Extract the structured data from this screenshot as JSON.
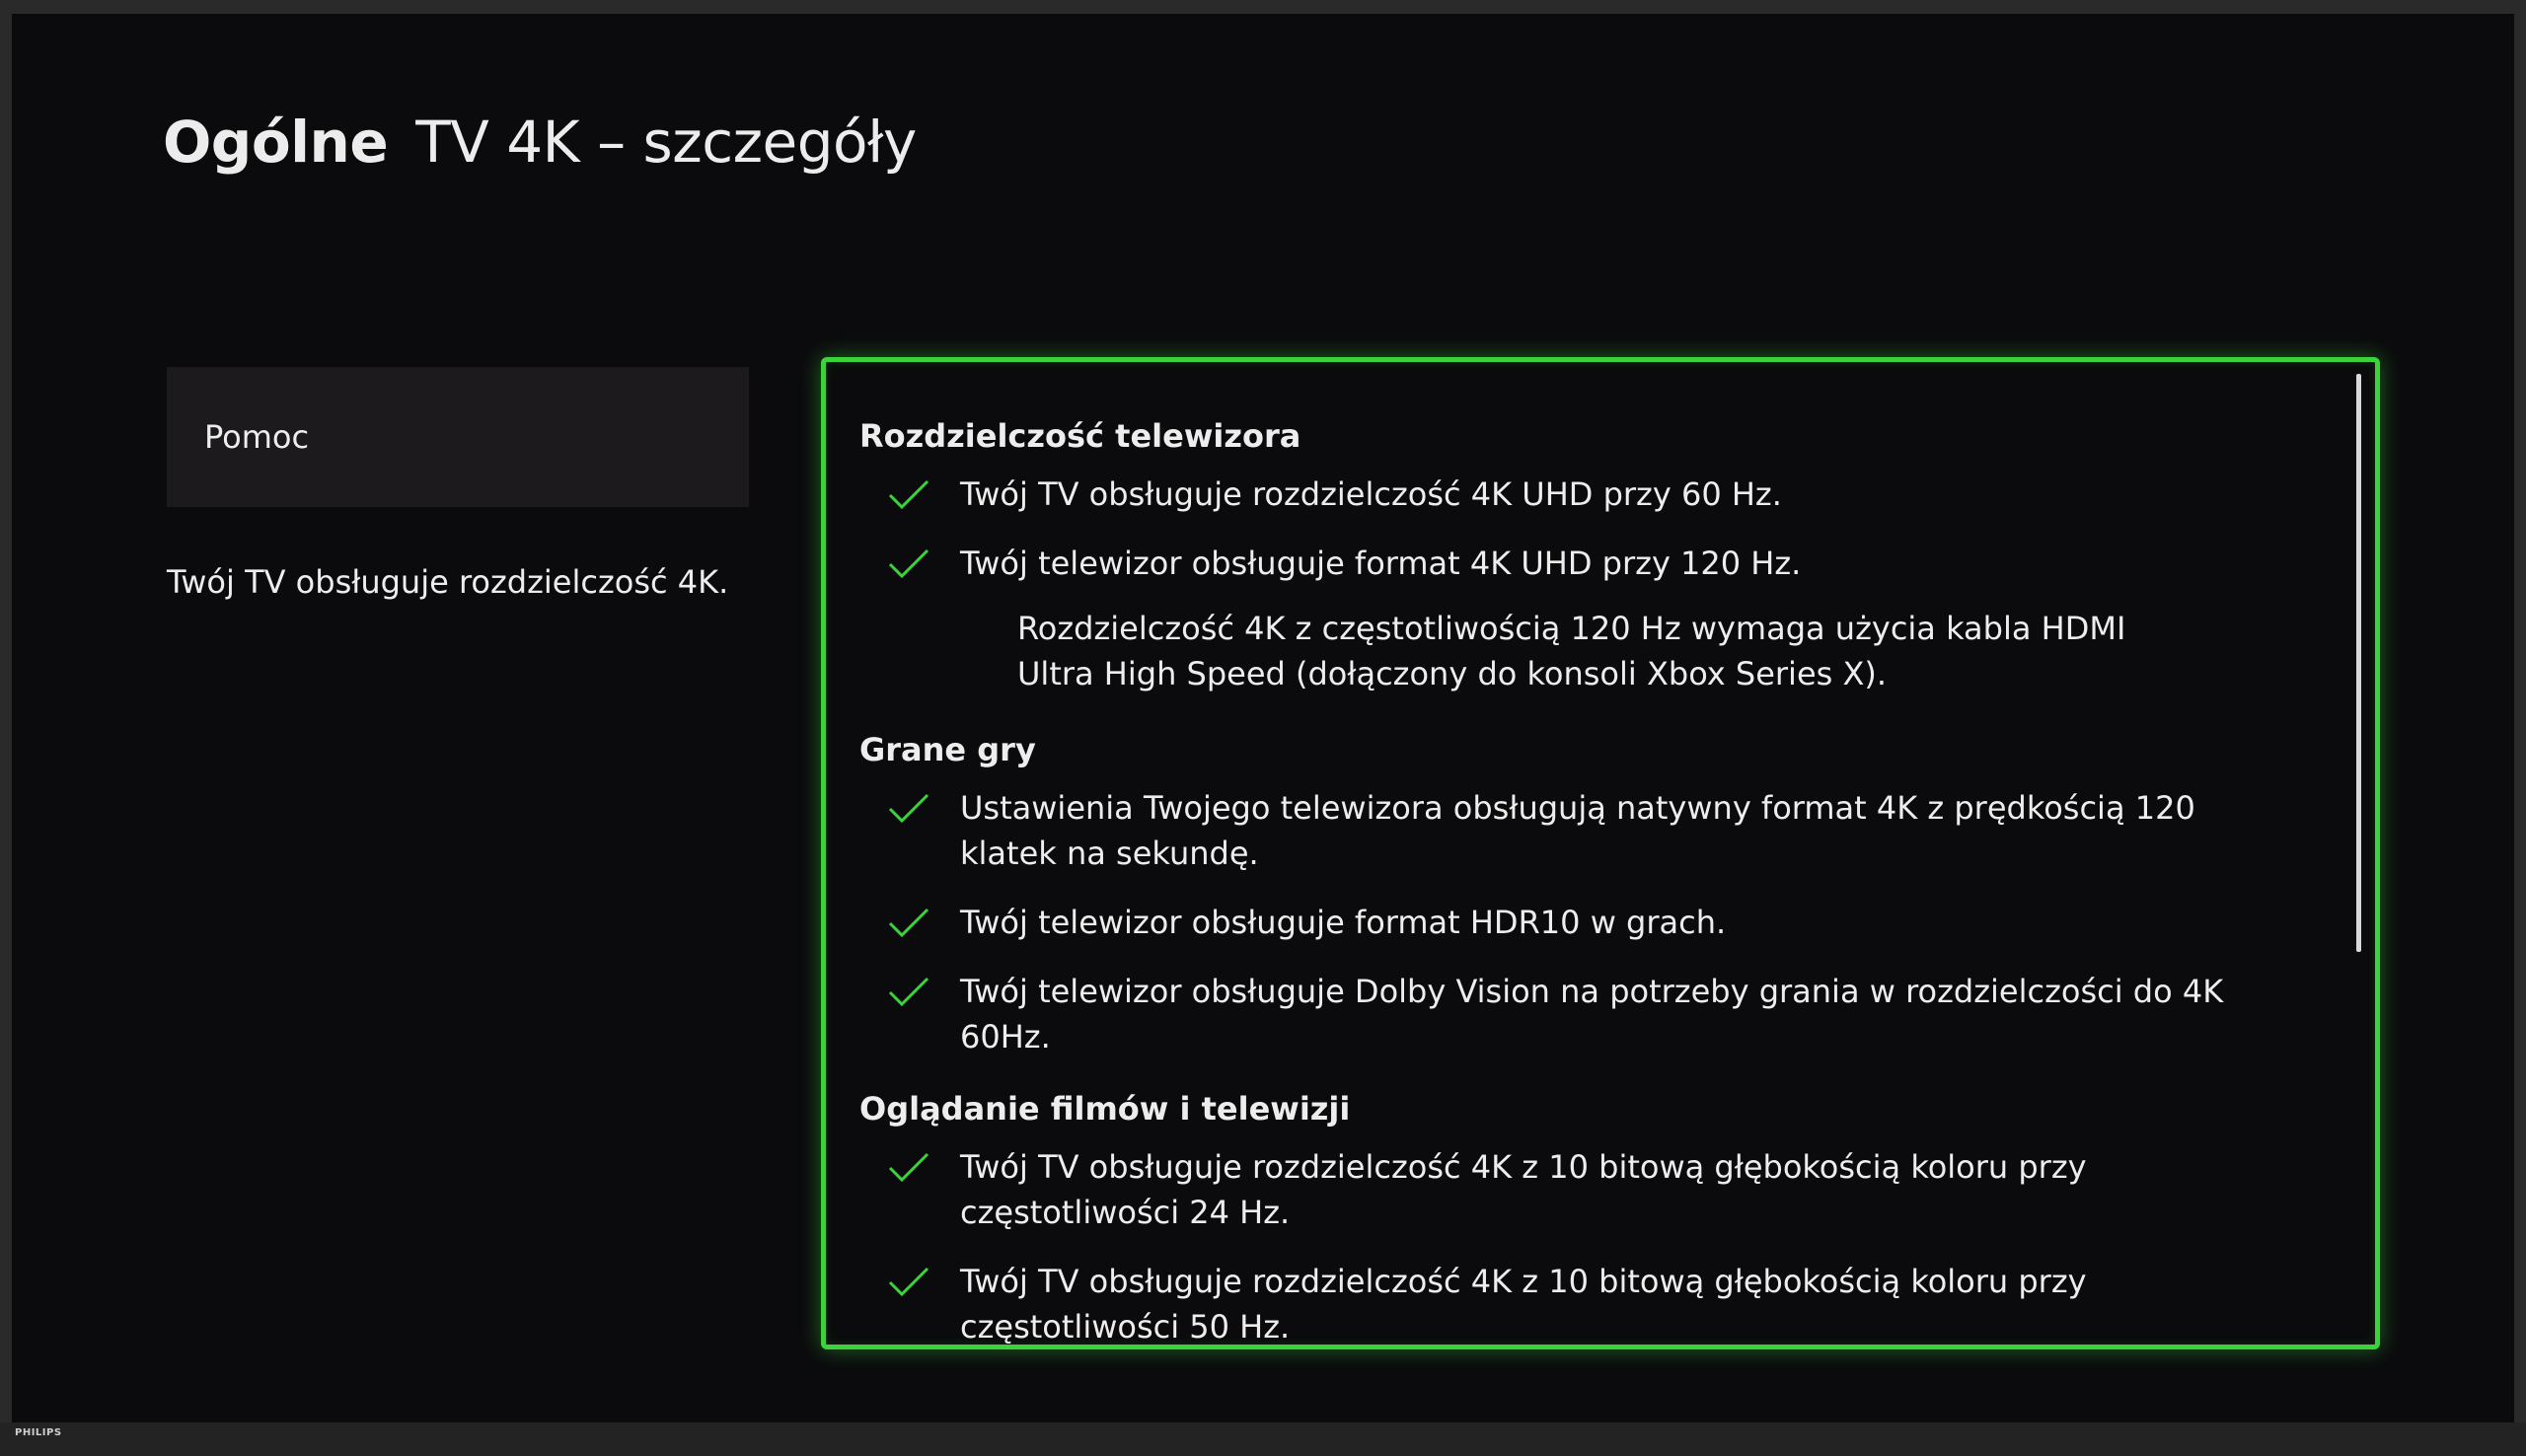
{
  "header": {
    "section": "Ogólne",
    "title": "TV 4K – szczegóły"
  },
  "sidebar": {
    "help_label": "Pomoc",
    "description": "Twój TV obsługuje rozdzielczość 4K."
  },
  "details": {
    "groups": [
      {
        "title": "Rozdzielczość telewizora",
        "items": [
          "Twój TV obsługuje rozdzielczość 4K UHD przy 60 Hz.",
          "Twój telewizor obsługuje format 4K UHD przy 120 Hz."
        ],
        "note": "Rozdzielczość 4K z częstotliwością 120 Hz wymaga użycia kabla HDMI Ultra High Speed (dołączony do konsoli Xbox Series X)."
      },
      {
        "title": "Grane gry",
        "items": [
          "Ustawienia Twojego telewizora obsługują natywny format 4K z prędkością 120 klatek na sekundę.",
          "Twój telewizor obsługuje format HDR10 w grach.",
          "Twój telewizor obsługuje Dolby Vision na potrzeby grania w rozdzielczości do 4K 60Hz."
        ]
      },
      {
        "title": "Oglądanie filmów i telewizji",
        "items": [
          "Twój TV obsługuje rozdzielczość 4K z 10 bitową głębokością koloru przy częstotliwości 24 Hz.",
          "Twój TV obsługuje rozdzielczość 4K z 10 bitową głębokością koloru przy częstotliwości 50 Hz."
        ]
      }
    ]
  },
  "bezel": {
    "brand": "PHILIPS"
  },
  "colors": {
    "accent": "#3bd33a",
    "check": "#3bd33a",
    "background": "#0b0b0d",
    "text": "#ededed"
  }
}
